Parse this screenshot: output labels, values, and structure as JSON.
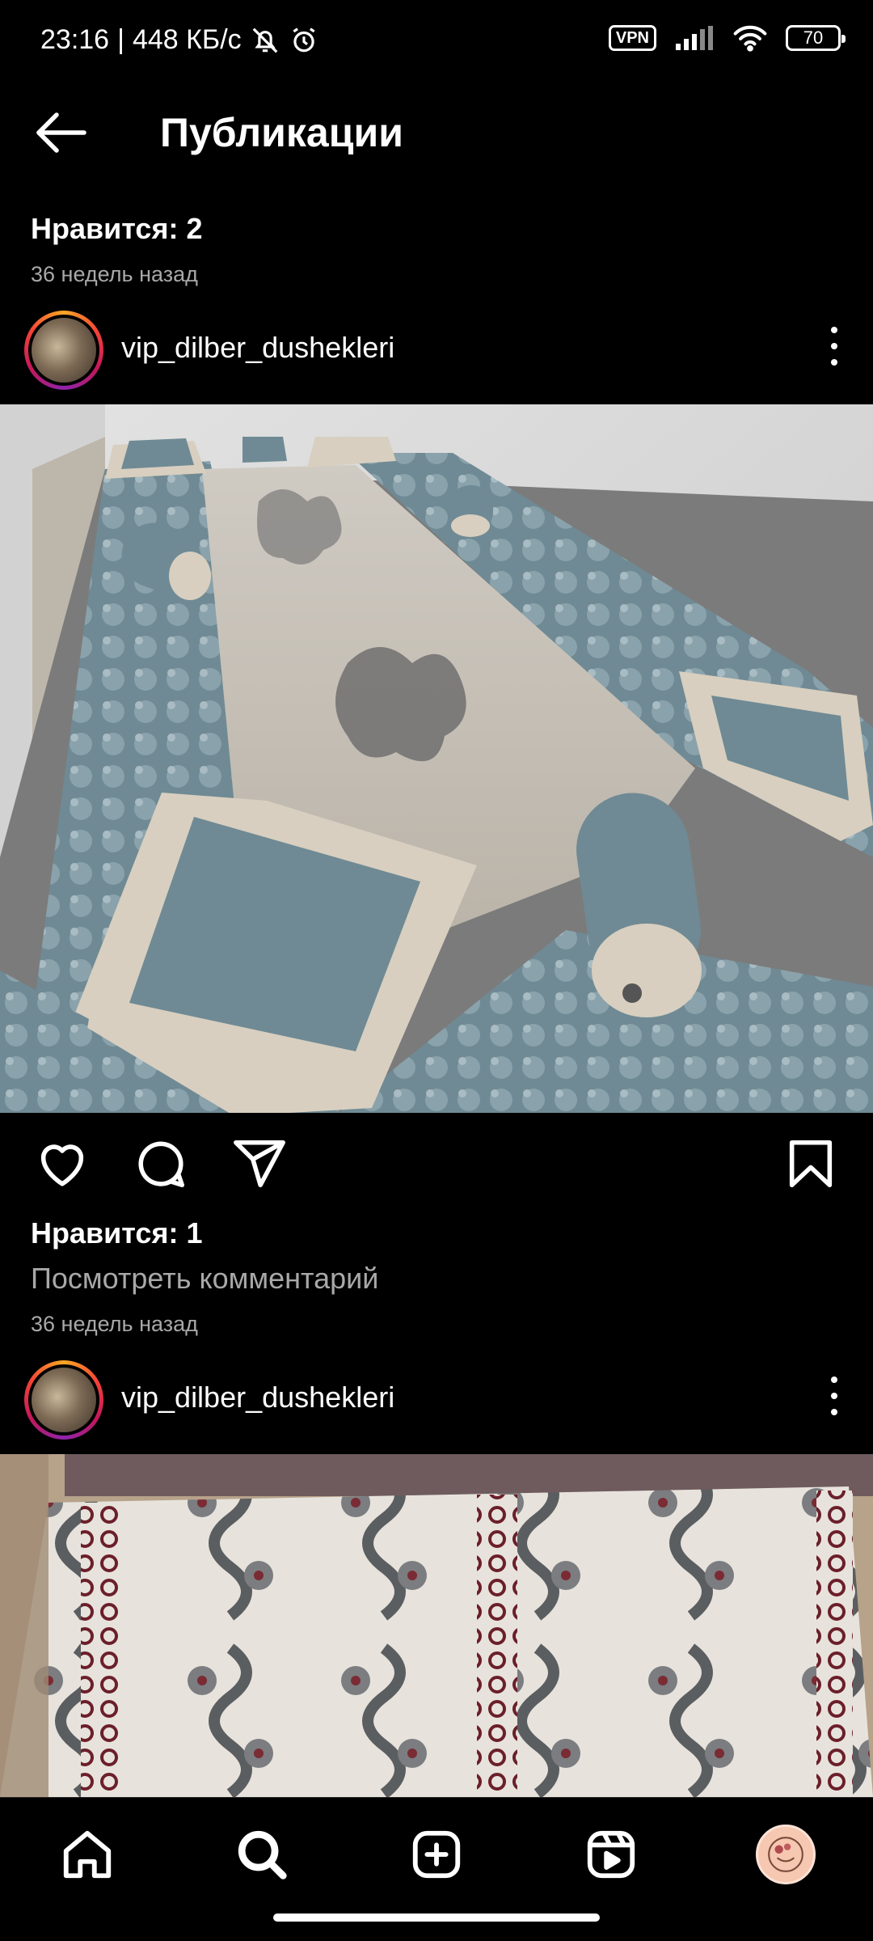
{
  "status_bar": {
    "time": "23:16",
    "speed": "448 КБ/с",
    "vpn": "VPN",
    "battery": "70",
    "icons": [
      "mute-icon",
      "alarm-icon",
      "signal-icon",
      "wifi-icon",
      "battery-icon"
    ]
  },
  "header": {
    "title": "Публикации",
    "back_icon": "arrow-left-icon"
  },
  "top_meta": {
    "likes": "Нравится: 2",
    "time_ago": "36 недель назад"
  },
  "posts": [
    {
      "username": "vip_dilber_dushekleri",
      "image_desc": "floor-mattress-set",
      "actions": [
        "heart-icon",
        "comment-icon",
        "share-icon",
        "bookmark-icon"
      ],
      "likes": "Нравится: 1",
      "view_comments": "Посмотреть комментарий",
      "time_ago": "36 недель назад"
    },
    {
      "username": "vip_dilber_dushekleri",
      "image_desc": "patterned-fabric-roll"
    }
  ],
  "bottom_nav": {
    "items": [
      "home-icon",
      "search-icon",
      "add-post-icon",
      "reels-icon",
      "profile-avatar"
    ]
  },
  "colors": {
    "background": "#000000",
    "text": "#ffffff",
    "secondary_text": "#a8a8a8",
    "fabric_blue": "#6f8a94",
    "fabric_beige": "#d9d0c2"
  }
}
